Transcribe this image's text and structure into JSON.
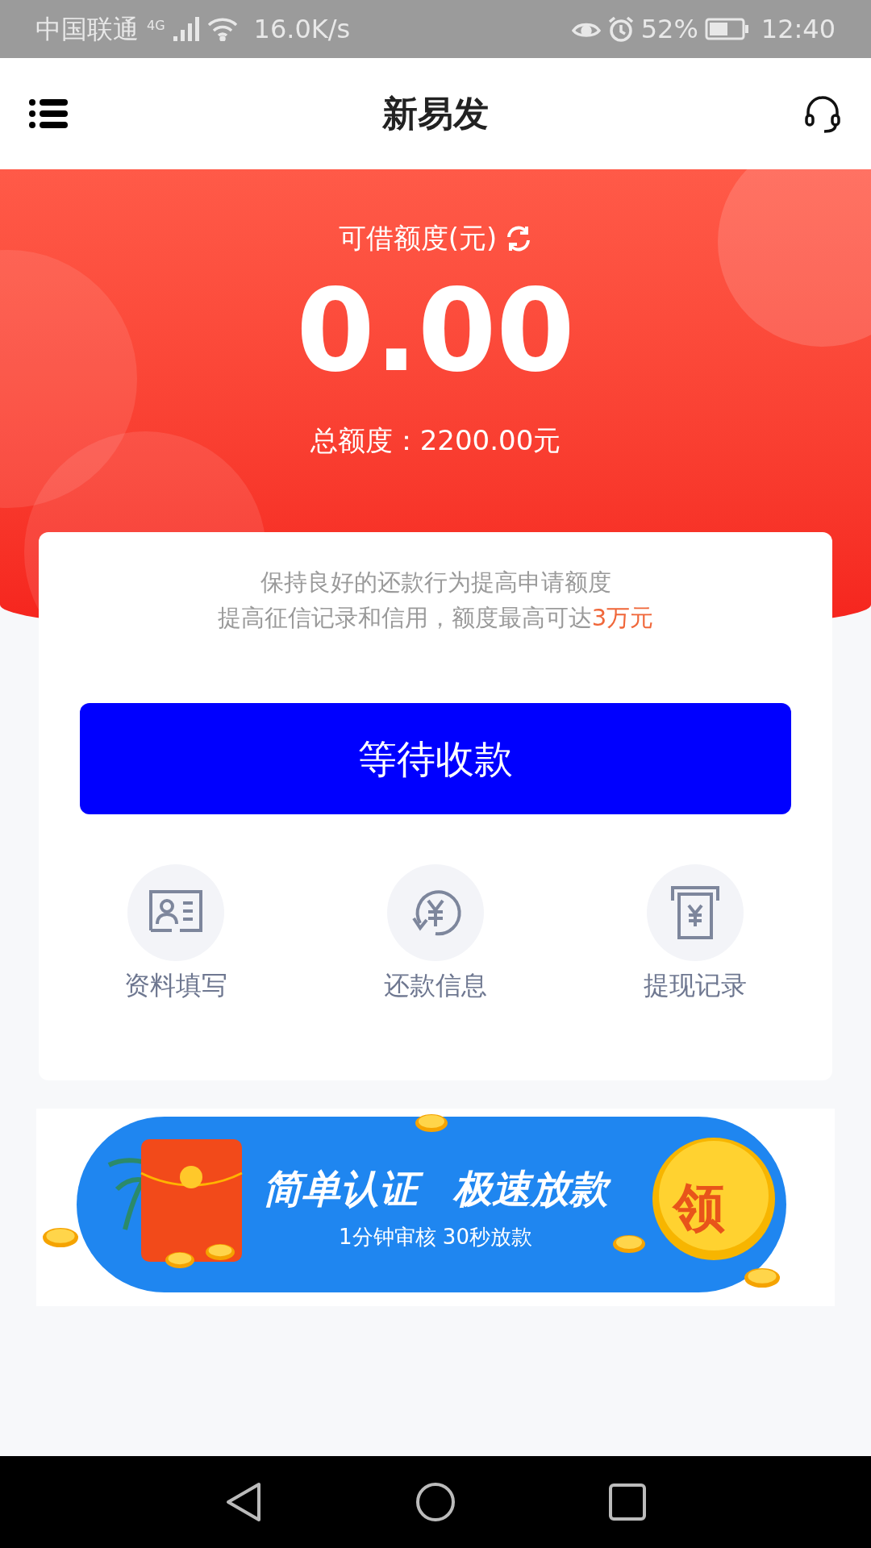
{
  "status_bar": {
    "carrier": "中国联通",
    "network": "4G",
    "speed": "16.0K/s",
    "battery": "52%",
    "time": "12:40"
  },
  "header": {
    "title": "新易发"
  },
  "credit": {
    "label": "可借额度(元)",
    "amount": "0.00",
    "total": "总额度：2200.00元"
  },
  "card": {
    "tip_line_1": "保持良好的还款行为提高申请额度",
    "tip_line_2": "提高征信记录和信用，额度最高可达",
    "tip_highlight": "3万元",
    "button": "等待收款",
    "shortcuts": [
      {
        "kind": "form",
        "label": "资料填写"
      },
      {
        "kind": "repay",
        "label": "还款信息"
      },
      {
        "kind": "withdraw",
        "label": "提现记录"
      }
    ]
  },
  "banner": {
    "title_1": "简单认证",
    "title_2": "极速放款",
    "subtitle": "1分钟审核 30秒放款",
    "badge": "领"
  }
}
